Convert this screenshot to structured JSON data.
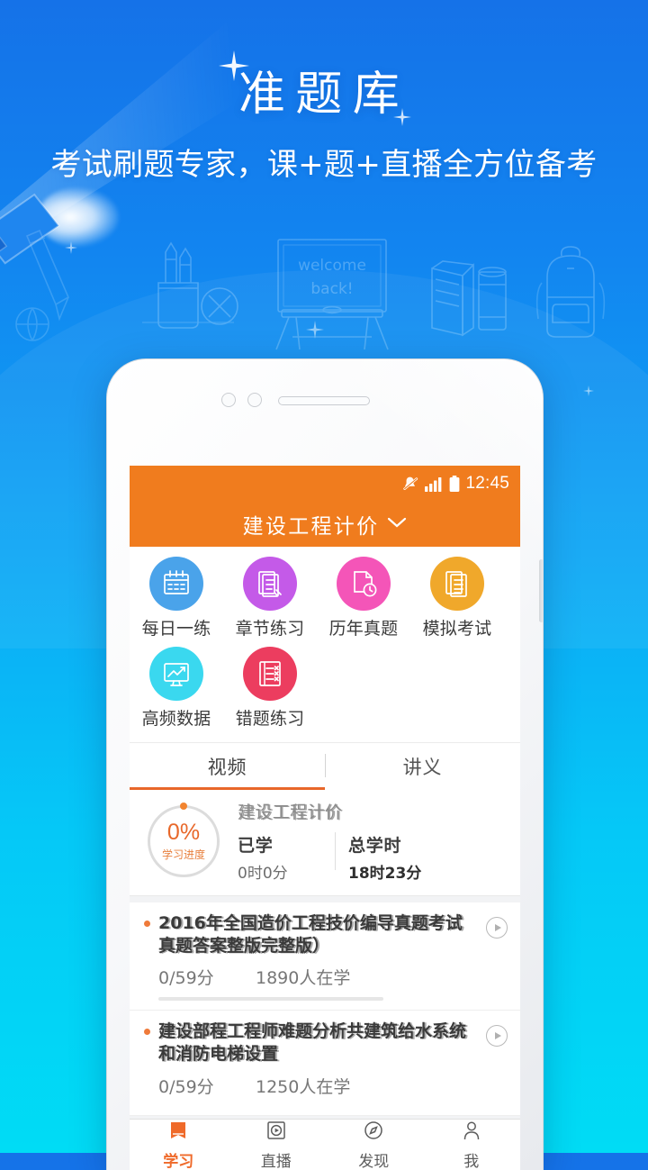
{
  "poster": {
    "title": "准题库",
    "subtitle": "考试刷题专家，课+题+直播全方位备考",
    "blackboard_line1": "welcome",
    "blackboard_line2": "back!",
    "colors": {
      "bg_top": "#1572e8",
      "bg_bottom": "#00dcf5",
      "accent_orange": "#f07c1e",
      "tab_underline": "#e8672a"
    }
  },
  "phone": {
    "statusbar": {
      "mute_icon": "bell-muted-icon",
      "signal_icon": "signal-bars-icon",
      "battery_icon": "battery-icon",
      "clock": "12:45"
    },
    "appbar": {
      "title": "建设工程计价",
      "chevron_icon": "chevron-down-icon"
    },
    "grid": [
      {
        "label": "每日一练",
        "icon": "calendar-icon",
        "color": "#4aa3ea"
      },
      {
        "label": "章节练习",
        "icon": "document-pen-icon",
        "color": "#c45ae8"
      },
      {
        "label": "历年真题",
        "icon": "document-clock-icon",
        "color": "#f455b8"
      },
      {
        "label": "模拟考试",
        "icon": "document-stack-icon",
        "color": "#f0a82b"
      },
      {
        "label": "高频数据",
        "icon": "chart-monitor-icon",
        "color": "#3ad8ef"
      },
      {
        "label": "错题练习",
        "icon": "checklist-cross-icon",
        "color": "#ec3d5f"
      }
    ],
    "tabs": [
      {
        "label": "视频",
        "active": true
      },
      {
        "label": "讲义",
        "active": false
      }
    ],
    "progress": {
      "percent": "0%",
      "percent_label": "学习进度",
      "course_title": "建设工程计价",
      "studied_key": "已学",
      "studied_value": "0时0分",
      "total_key": "总学时",
      "total_value": "18时23分"
    },
    "courses": [
      {
        "title": "2016年全国造价工程技价编导真题考试真题答案整版完整版）",
        "score": "0/59分",
        "learners": "1890人在学",
        "play_icon": "play-circle-icon"
      },
      {
        "title": "建设部程工程师难题分析共建筑给水系统和消防电梯设置",
        "score": "0/59分",
        "learners": "1250人在学",
        "play_icon": "play-circle-icon"
      }
    ],
    "bottom_nav": [
      {
        "label": "学习",
        "icon": "book-icon",
        "active": true
      },
      {
        "label": "直播",
        "icon": "play-square-icon",
        "active": false
      },
      {
        "label": "发现",
        "icon": "compass-icon",
        "active": false
      },
      {
        "label": "我",
        "icon": "person-icon",
        "active": false
      }
    ]
  }
}
